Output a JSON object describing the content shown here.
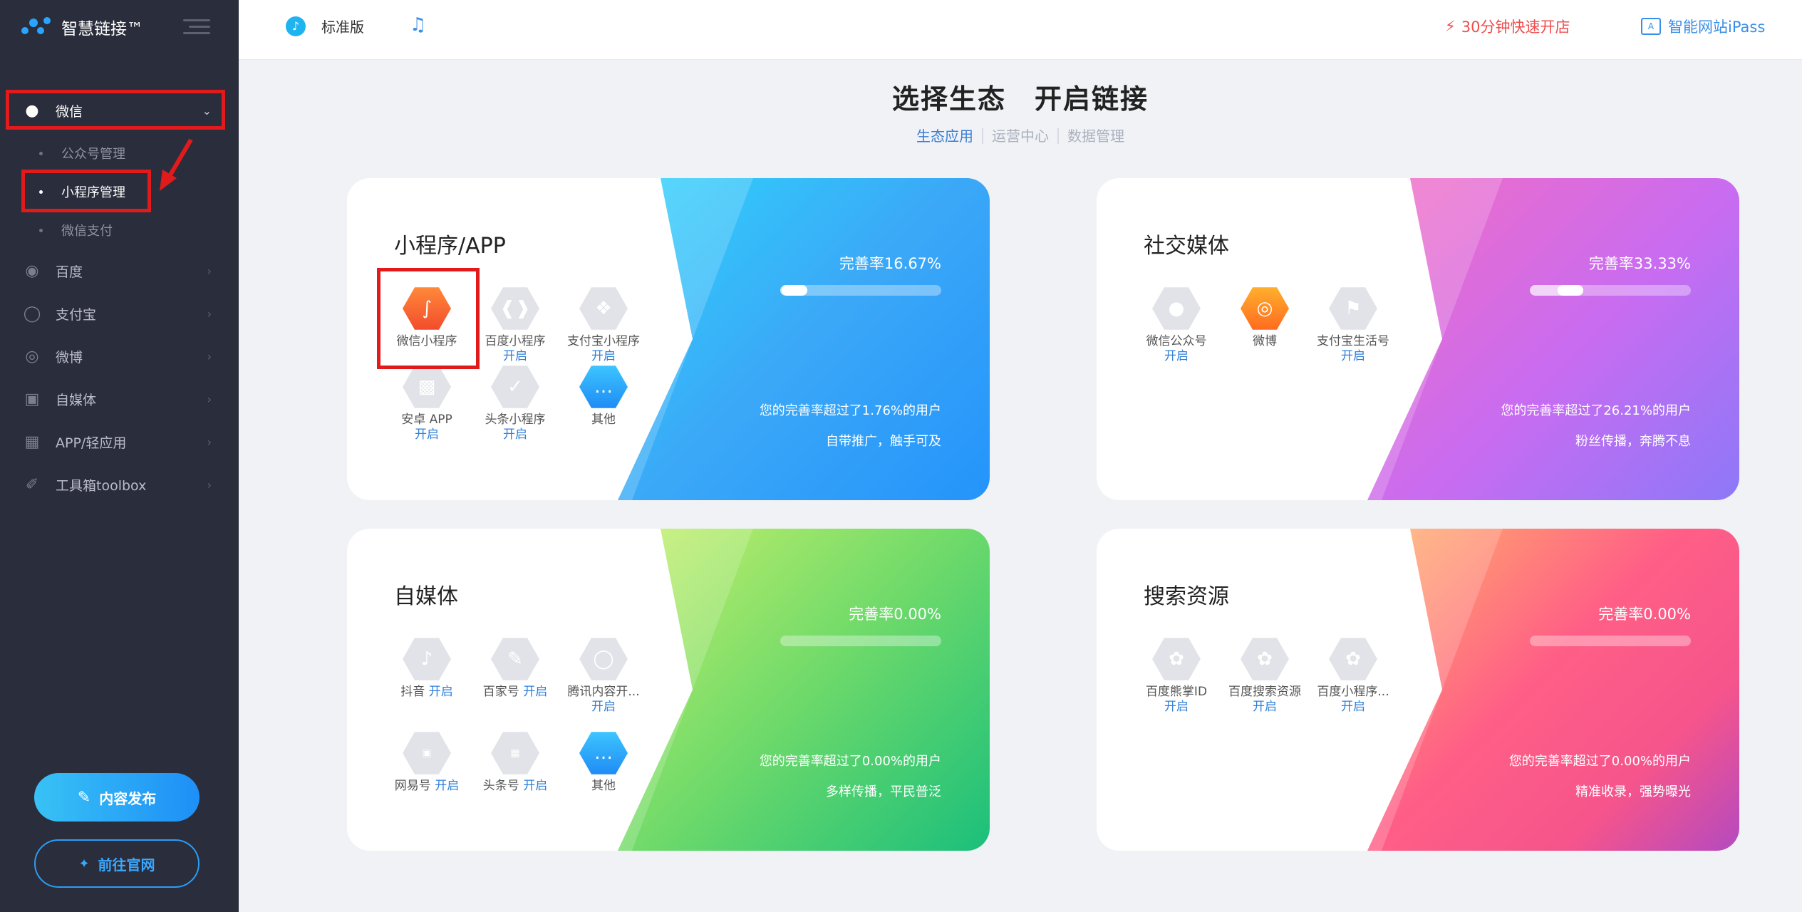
{
  "sidebar": {
    "brand": "智慧链接™",
    "menu": [
      {
        "label": "微信",
        "icon": "wechat-icon"
      },
      {
        "label": "百度",
        "icon": "paw-icon"
      },
      {
        "label": "支付宝",
        "icon": "alipay-icon"
      },
      {
        "label": "微博",
        "icon": "weibo-icon"
      },
      {
        "label": "自媒体",
        "icon": "media-icon"
      },
      {
        "label": "APP/轻应用",
        "icon": "app-grid-icon"
      },
      {
        "label": "工具箱toolbox",
        "icon": "wrench-icon"
      }
    ],
    "wechat_sub": [
      "公众号管理",
      "小程序管理",
      "微信支付"
    ],
    "publish_button": "内容发布",
    "site_button": "前往官网"
  },
  "topbar": {
    "edition": "标准版",
    "quick_open": "30分钟快速开店",
    "ipass": "智能网站iPass"
  },
  "header": {
    "title": "选择生态　开启链接",
    "tabs": [
      "生态应用",
      "运营中心",
      "数据管理"
    ]
  },
  "cards": [
    {
      "title": "小程序/APP",
      "rate": "完善率16.67%",
      "rate_value": 0.1667,
      "rank": "您的完善率超过了1.76%的用户",
      "slogan": "自带推广，触手可及",
      "apps": [
        {
          "name": "微信小程序",
          "status": "",
          "icon": "mini-program-icon"
        },
        {
          "name": "百度小程序",
          "status": "开启",
          "icon": "baidu-smart-icon"
        },
        {
          "name": "支付宝小程序",
          "status": "开启",
          "icon": "alipay-mini-icon"
        },
        {
          "name": "安卓 APP",
          "status": "开启",
          "icon": "android-icon"
        },
        {
          "name": "头条小程序",
          "status": "开启",
          "icon": "toutiao-mini-icon"
        },
        {
          "name": "其他",
          "status": "",
          "icon": "more-icon"
        }
      ]
    },
    {
      "title": "社交媒体",
      "rate": "完善率33.33%",
      "rate_value": 0.3333,
      "rank": "您的完善率超过了26.21%的用户",
      "slogan": "粉丝传播，奔腾不息",
      "apps": [
        {
          "name": "微信公众号",
          "status": "开启",
          "icon": "wechat-official-icon"
        },
        {
          "name": "微博",
          "status": "",
          "icon": "weibo-icon"
        },
        {
          "name": "支付宝生活号",
          "status": "开启",
          "icon": "alipay-life-icon"
        }
      ]
    },
    {
      "title": "自媒体",
      "rate": "完善率0.00%",
      "rate_value": 0,
      "rank": "您的完善率超过了0.00%的用户",
      "slogan": "多样传播，平民普泛",
      "apps": [
        {
          "name": "抖音",
          "status": "开启",
          "icon": "douyin-icon"
        },
        {
          "name": "百家号",
          "status": "开启",
          "icon": "baijiahao-icon"
        },
        {
          "name": "腾讯内容开...",
          "status": "开启",
          "icon": "tencent-icon"
        },
        {
          "name": "网易号",
          "status": "开启",
          "icon": "netease-icon"
        },
        {
          "name": "头条号",
          "status": "开启",
          "icon": "toutiao-icon"
        },
        {
          "name": "其他",
          "status": "",
          "icon": "more-icon"
        }
      ]
    },
    {
      "title": "搜索资源",
      "rate": "完善率0.00%",
      "rate_value": 0,
      "rank": "您的完善率超过了0.00%的用户",
      "slogan": "精准收录，强势曝光",
      "apps": [
        {
          "name": "百度熊掌ID",
          "status": "开启",
          "icon": "paw-icon"
        },
        {
          "name": "百度搜索资源",
          "status": "开启",
          "icon": "paw-icon"
        },
        {
          "name": "百度小程序...",
          "status": "开启",
          "icon": "paw-icon"
        }
      ]
    }
  ]
}
